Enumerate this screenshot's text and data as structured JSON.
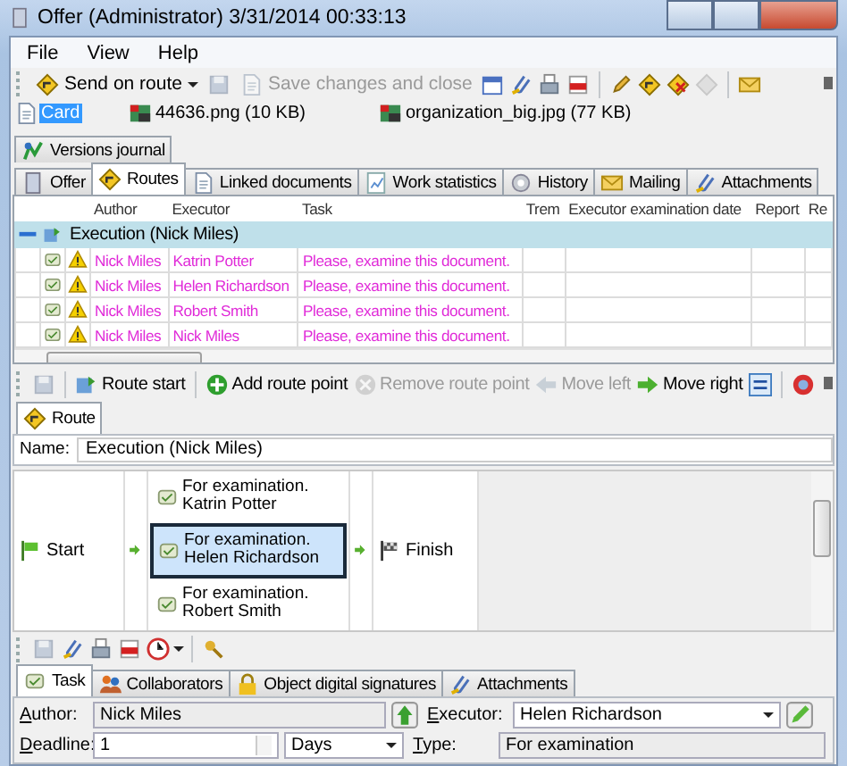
{
  "window": {
    "title": "Offer (Administrator) 3/31/2014 00:33:13"
  },
  "menu": [
    "File",
    "View",
    "Help"
  ],
  "toolbar": [
    {
      "label": "Send on route",
      "disabled": false
    },
    {
      "label": "Save changes and close",
      "disabled": true
    }
  ],
  "files": [
    {
      "label": "Card",
      "selected": true,
      "kind": "card"
    },
    {
      "label": "44636.png (10 KB)",
      "selected": false,
      "kind": "image"
    },
    {
      "label": "organization_big.jpg (77 KB)",
      "selected": false,
      "kind": "image"
    }
  ],
  "tab_rows": [
    [
      {
        "label": "Versions journal",
        "selected": false
      }
    ],
    [
      {
        "label": "Offer",
        "selected": false
      },
      {
        "label": "Routes",
        "selected": true
      },
      {
        "label": "Linked documents",
        "selected": false
      },
      {
        "label": "Work statistics",
        "selected": false
      },
      {
        "label": "History",
        "selected": false
      },
      {
        "label": "Mailing",
        "selected": false
      },
      {
        "label": "Attachments",
        "selected": false
      }
    ]
  ],
  "grid": {
    "columns": [
      "Author",
      "Executor",
      "Task",
      "Trem",
      "Executor examination date",
      "Report",
      "Re"
    ],
    "group": {
      "label": "Execution (Nick Miles)",
      "expanded": true
    },
    "rows": [
      {
        "author": "Nick Miles",
        "executor": "Katrin Potter",
        "task": "Please, examine this document."
      },
      {
        "author": "Nick Miles",
        "executor": "Helen Richardson",
        "task": "Please, examine this document."
      },
      {
        "author": "Nick Miles",
        "executor": "Robert Smith",
        "task": "Please, examine this document."
      },
      {
        "author": "Nick Miles",
        "executor": "Nick Miles",
        "task": "Please, examine this document."
      }
    ]
  },
  "route_toolbar": [
    {
      "label": "Route start",
      "disabled": false
    },
    {
      "label": "Add route point",
      "disabled": false
    },
    {
      "label": "Remove route point",
      "disabled": true
    },
    {
      "label": "Move left",
      "disabled": true
    },
    {
      "label": "Move right",
      "disabled": false
    }
  ],
  "route_tabs": [
    {
      "label": "Route",
      "selected": true
    }
  ],
  "name_field": {
    "label": "Name:",
    "value": "Execution (Nick Miles)"
  },
  "diagram": {
    "start": "Start",
    "finish": "Finish",
    "stages": [
      {
        "label": "For examination. Katrin Potter",
        "selected": false
      },
      {
        "label": "For examination. Helen Richardson",
        "selected": true
      },
      {
        "label": "For examination. Robert Smith",
        "selected": false
      }
    ]
  },
  "task_tabs": [
    {
      "label": "Task",
      "selected": true
    },
    {
      "label": "Collaborators",
      "selected": false
    },
    {
      "label": "Object digital signatures",
      "selected": false
    },
    {
      "label": "Attachments",
      "selected": false
    }
  ],
  "form": {
    "author": {
      "label": "Author:",
      "value": "Nick Miles"
    },
    "executor": {
      "label": "Executor:",
      "value": "Helen Richardson"
    },
    "deadline": {
      "label": "Deadline:",
      "value": "1",
      "unit": "Days"
    },
    "type": {
      "label": "Type:",
      "value": "For examination"
    }
  }
}
